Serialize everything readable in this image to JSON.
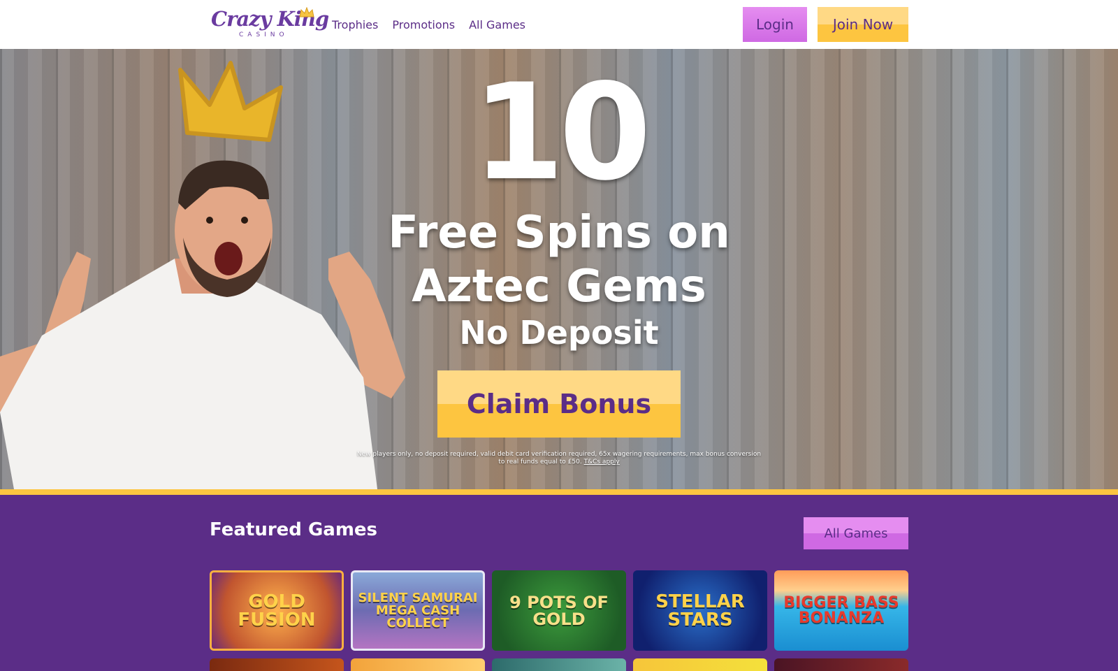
{
  "header": {
    "logo": {
      "main": "Crazy King",
      "sub": "CASINO"
    },
    "nav": [
      {
        "label": "Trophies"
      },
      {
        "label": "Promotions"
      },
      {
        "label": "All Games"
      }
    ],
    "login_label": "Login",
    "join_label": "Join Now"
  },
  "hero": {
    "number": "10",
    "line1": "Free Spins on",
    "line2": "Aztec Gems",
    "line3": "No Deposit",
    "cta_label": "Claim Bonus",
    "terms_text": "New players only, no deposit required, valid debit card verification required, 65x wagering requirements, max bonus conversion to real funds equal to £50. ",
    "terms_link": "T&Cs apply"
  },
  "featured": {
    "title": "Featured Games",
    "all_games_label": "All Games",
    "games": [
      {
        "name": "GOLD FUSION"
      },
      {
        "name": "SILENT SAMURAI MEGA CASH COLLECT"
      },
      {
        "name": "9 POTS OF GOLD"
      },
      {
        "name": "STELLAR STARS"
      },
      {
        "name": "BIGGER BASS BONANZA"
      }
    ]
  },
  "colors": {
    "brand_purple": "#5b2d87",
    "gold": "#fdc540",
    "pink": "#e58df0"
  }
}
